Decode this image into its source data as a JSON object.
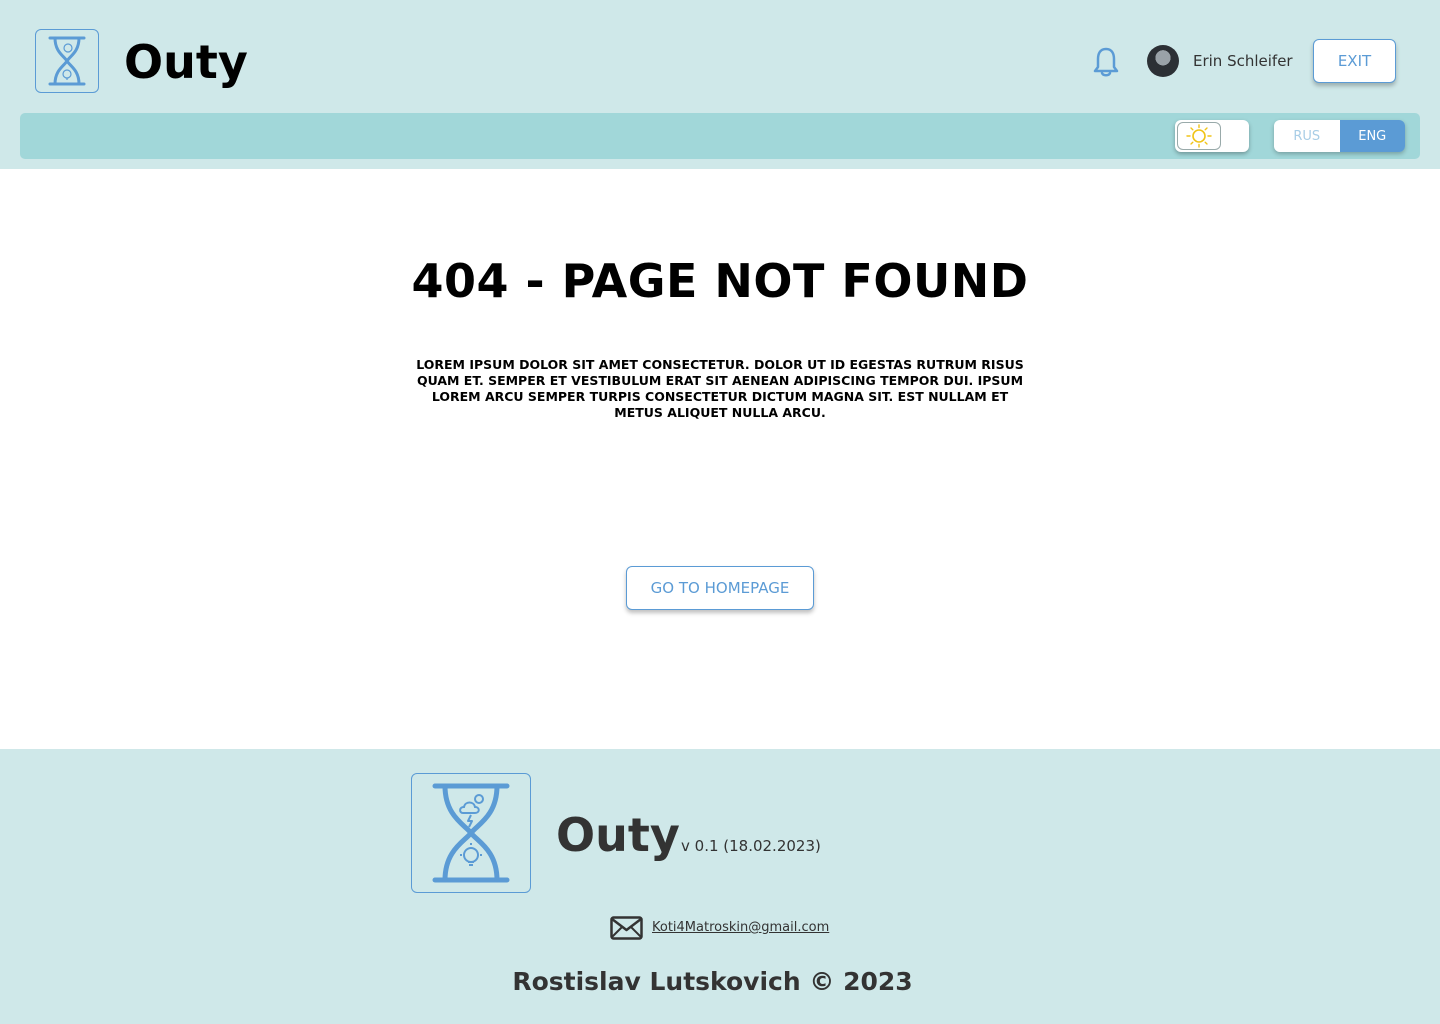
{
  "header": {
    "brand": "Outy",
    "user_name": "Erin Schleifer",
    "exit_label": "EXIT",
    "icons": {
      "logo": "hourglass-logo-icon",
      "bell": "bell-icon",
      "theme": "sun-icon"
    },
    "lang": {
      "rus": "RUS",
      "eng": "ENG",
      "active": "ENG"
    }
  },
  "main": {
    "title": "404 - PAGE NOT FOUND",
    "description": "LOREM IPSUM DOLOR SIT AMET CONSECTETUR. DOLOR UT ID EGESTAS RUTRUM RISUS QUAM ET. SEMPER ET VESTIBULUM ERAT SIT AENEAN ADIPISCING TEMPOR DUI. IPSUM LOREM ARCU SEMPER TURPIS CONSECTETUR DICTUM MAGNA SIT. EST NULLAM ET METUS ALIQUET NULLA ARCU.",
    "home_button": "GO TO HOMEPAGE"
  },
  "footer": {
    "brand": "Outy",
    "version": "v 0.1 (18.02.2023)",
    "email": "Koti4Matroskin@gmail.com",
    "copyright": "Rostislav Lutskovich © 2023"
  },
  "colors": {
    "header_bg": "#cfe8e9",
    "toolbar_bg": "#a1d7d9",
    "accent": "#5b9bd5",
    "text_dark": "#333333"
  }
}
